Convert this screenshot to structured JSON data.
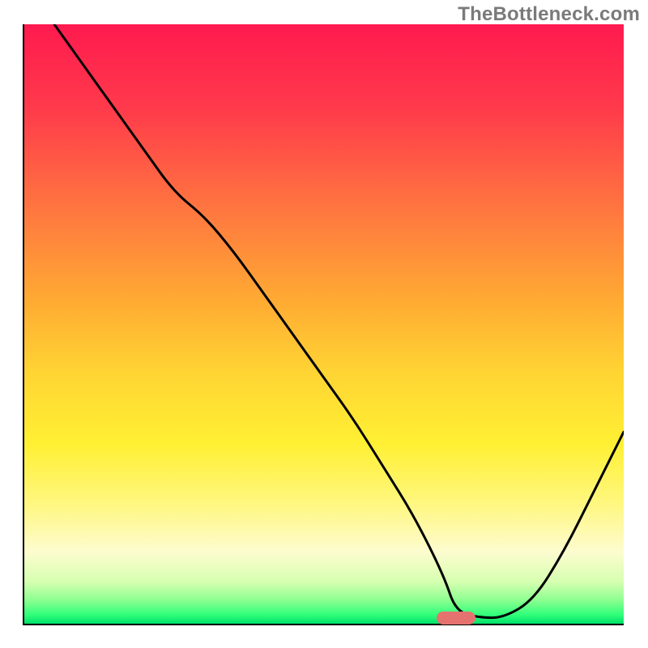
{
  "watermark": "TheBottleneck.com",
  "chart_data": {
    "type": "line",
    "title": "",
    "xlabel": "",
    "ylabel": "",
    "xlim": [
      0,
      100
    ],
    "ylim": [
      0,
      100
    ],
    "x": [
      5,
      10,
      15,
      20,
      25,
      30,
      35,
      40,
      45,
      50,
      55,
      60,
      65,
      70,
      72,
      76,
      80,
      85,
      90,
      95,
      100
    ],
    "values": [
      100,
      93,
      86,
      79,
      72,
      68,
      62,
      55,
      48,
      41,
      34,
      26,
      18,
      8,
      2,
      1,
      1,
      4,
      12,
      22,
      32
    ],
    "marker": {
      "x": 72,
      "y": 1
    },
    "colors": {
      "gradient_top": "#ff1a4f",
      "gradient_bottom": "#00e06a",
      "curve": "#000000",
      "marker": "#e6726f"
    }
  }
}
